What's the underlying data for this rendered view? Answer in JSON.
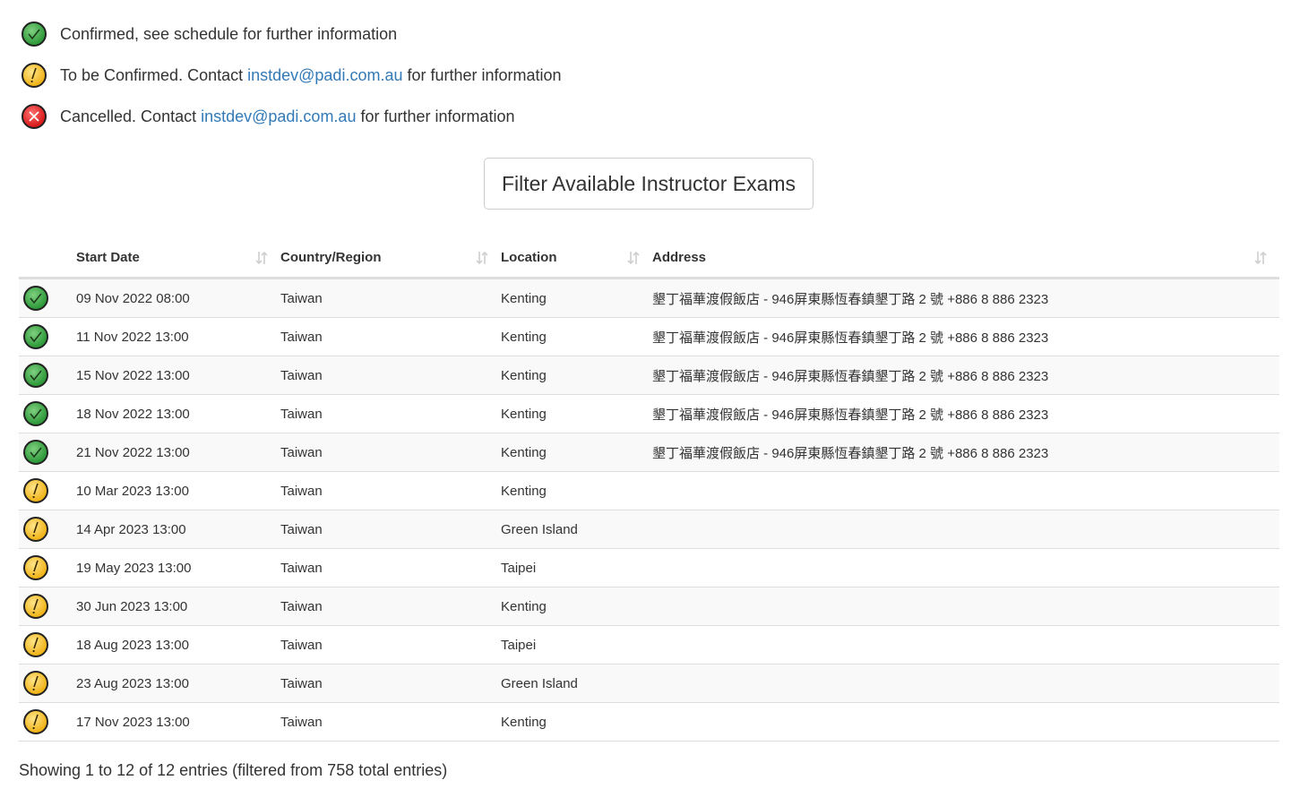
{
  "legend": {
    "confirmed": {
      "text": "Confirmed, see schedule for further information"
    },
    "tbc": {
      "prefix": "To be Confirmed. Contact ",
      "email": "instdev@padi.com.au",
      "suffix": " for further information"
    },
    "cancelled": {
      "prefix": "Cancelled. Contact ",
      "email": "instdev@padi.com.au",
      "suffix": " for further information"
    }
  },
  "filter_button": {
    "label": "Filter Available Instructor Exams"
  },
  "table": {
    "headers": {
      "start_date": "Start Date",
      "country": "Country/Region",
      "location": "Location",
      "address": "Address"
    },
    "rows": [
      {
        "status": "confirmed",
        "date": "09 Nov 2022 08:00",
        "country": "Taiwan",
        "location": "Kenting",
        "address": "墾丁福華渡假飯店 - 946屏東縣恆春鎮墾丁路 2 號 +886 8 886 2323"
      },
      {
        "status": "confirmed",
        "date": "11 Nov 2022 13:00",
        "country": "Taiwan",
        "location": "Kenting",
        "address": "墾丁福華渡假飯店 - 946屏東縣恆春鎮墾丁路 2 號 +886 8 886 2323"
      },
      {
        "status": "confirmed",
        "date": "15 Nov 2022 13:00",
        "country": "Taiwan",
        "location": "Kenting",
        "address": "墾丁福華渡假飯店 - 946屏東縣恆春鎮墾丁路 2 號 +886 8 886 2323"
      },
      {
        "status": "confirmed",
        "date": "18 Nov 2022 13:00",
        "country": "Taiwan",
        "location": "Kenting",
        "address": "墾丁福華渡假飯店 - 946屏東縣恆春鎮墾丁路 2 號 +886 8 886 2323"
      },
      {
        "status": "confirmed",
        "date": "21 Nov 2022 13:00",
        "country": "Taiwan",
        "location": "Kenting",
        "address": "墾丁福華渡假飯店 - 946屏東縣恆春鎮墾丁路 2 號 +886 8 886 2323"
      },
      {
        "status": "tbc",
        "date": "10 Mar 2023 13:00",
        "country": "Taiwan",
        "location": "Kenting",
        "address": ""
      },
      {
        "status": "tbc",
        "date": "14 Apr 2023 13:00",
        "country": "Taiwan",
        "location": "Green Island",
        "address": ""
      },
      {
        "status": "tbc",
        "date": "19 May 2023 13:00",
        "country": "Taiwan",
        "location": "Taipei",
        "address": ""
      },
      {
        "status": "tbc",
        "date": "30 Jun 2023 13:00",
        "country": "Taiwan",
        "location": "Kenting",
        "address": ""
      },
      {
        "status": "tbc",
        "date": "18 Aug 2023 13:00",
        "country": "Taiwan",
        "location": "Taipei",
        "address": ""
      },
      {
        "status": "tbc",
        "date": "23 Aug 2023 13:00",
        "country": "Taiwan",
        "location": "Green Island",
        "address": ""
      },
      {
        "status": "tbc",
        "date": "17 Nov 2023 13:00",
        "country": "Taiwan",
        "location": "Kenting",
        "address": ""
      }
    ]
  },
  "footer": {
    "info": "Showing 1 to 12 of 12 entries (filtered from 758 total entries)"
  },
  "colors": {
    "confirmed": "#2e9a3a",
    "tbc": "#f0b419",
    "cancelled": "#d81b1b",
    "link": "#337ab7"
  },
  "icons": {
    "confirmed": "check-circle-icon",
    "tbc": "exclamation-circle-icon",
    "cancelled": "x-circle-icon",
    "sort": "sort-icon"
  }
}
